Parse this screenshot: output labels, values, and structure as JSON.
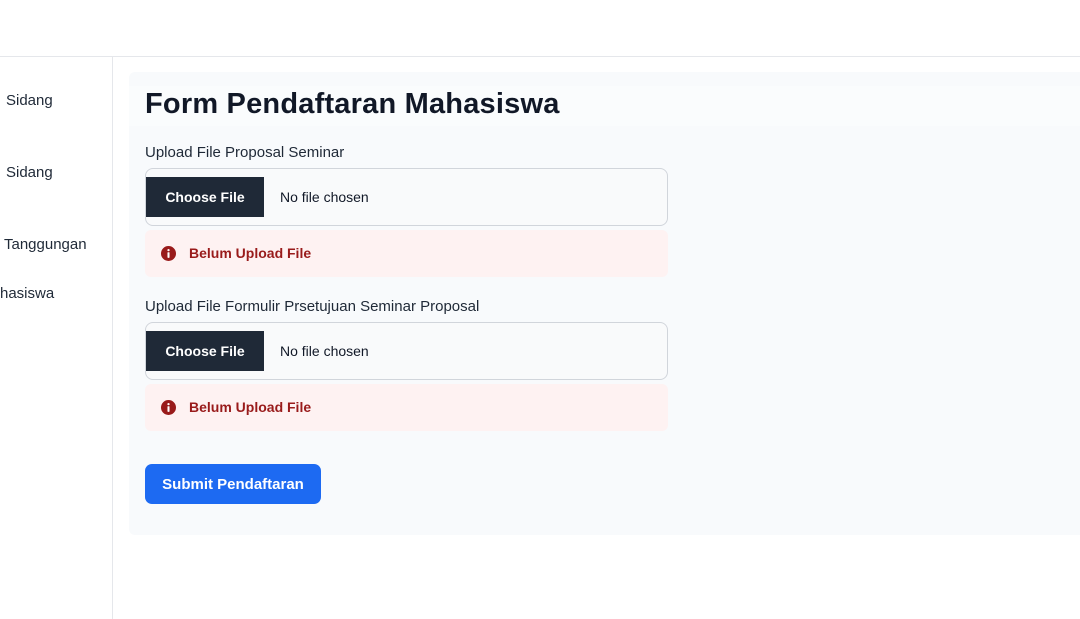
{
  "sidebar": {
    "items": [
      {
        "label": "Sidang"
      },
      {
        "label": "Sidang"
      },
      {
        "label": "Tanggungan"
      },
      {
        "label": "hasiswa"
      }
    ]
  },
  "form": {
    "title": "Form Pendaftaran Mahasiswa",
    "fields": [
      {
        "label": "Upload File Proposal Seminar",
        "button_label": "Choose File",
        "status": "No file chosen",
        "error": "Belum Upload File"
      },
      {
        "label": "Upload File Formulir Prsetujuan Seminar Proposal",
        "button_label": "Choose File",
        "status": "No file chosen",
        "error": "Belum Upload File"
      }
    ],
    "submit_label": "Submit Pendaftaran"
  },
  "colors": {
    "primary": "#1d6af2",
    "dark_button": "#1f2937",
    "error_text": "#991b1b",
    "error_bg": "#fef2f2"
  }
}
